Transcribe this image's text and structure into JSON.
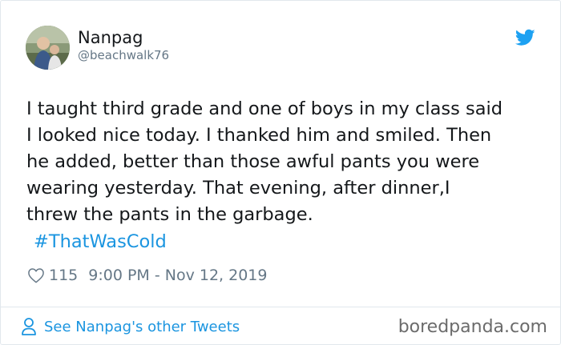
{
  "tweet": {
    "display_name": "Nanpag",
    "handle": "@beachwalk76",
    "text": "I taught third grade and one of boys in my class said\nI looked nice today. I thanked him and smiled. Then\nhe added, better than those awful pants you were\nwearing yesterday. That evening, after dinner,I\nthrew the pants in the garbage.",
    "hashtag": "#ThatWasCold",
    "like_count": "115",
    "timestamp": "9:00 PM - Nov 12, 2019"
  },
  "footer": {
    "see_more_label": "See Nanpag's other Tweets"
  },
  "watermark": "boredpanda.com",
  "icons": {
    "brand": "twitter-bird-icon",
    "like": "heart-icon",
    "profile": "person-icon"
  },
  "colors": {
    "twitter_blue": "#1da1f2",
    "link_blue": "#1b95e0",
    "text": "#14171a",
    "muted": "#657786"
  }
}
